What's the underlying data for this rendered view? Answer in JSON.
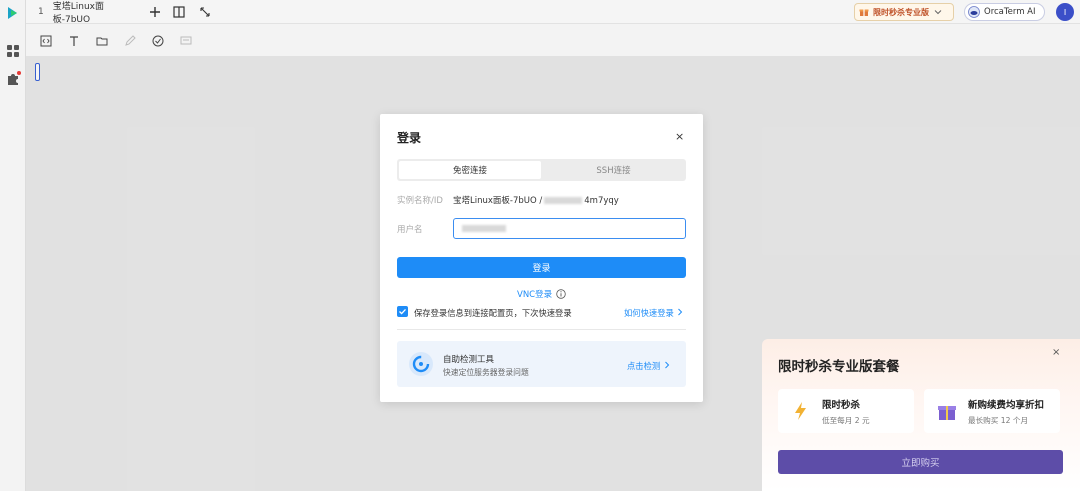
{
  "tab": {
    "number": "1",
    "title": "宝塔Linux面板-7bUO"
  },
  "header": {
    "promo_label": "限时秒杀专业版",
    "orca_label": "OrcaTerm AI",
    "avatar_initial": "I"
  },
  "modal": {
    "title": "登录",
    "close": "×",
    "tabs": [
      {
        "label": "免密连接",
        "active": true
      },
      {
        "label": "SSH连接",
        "active": false
      }
    ],
    "instance_label": "实例名称/ID",
    "instance_name": "宝塔Linux面板-7bUO /",
    "instance_id_suffix": "4m7yqy",
    "username_label": "用户名",
    "login_button": "登录",
    "vnc_link": "VNC登录",
    "save_checked": true,
    "save_label": "保存登录信息到连接配置页，下次快速登录",
    "quick_link": "如何快速登录",
    "tool_title": "自助检测工具",
    "tool_desc": "快速定位服务器登录问题",
    "tool_action": "点击检测"
  },
  "promo_panel": {
    "title": "限时秒杀专业版套餐",
    "close": "×",
    "cards": [
      {
        "title": "限时秒杀",
        "desc": "低至每月 2 元"
      },
      {
        "title": "新购续费均享折扣",
        "desc": "最长购买 12 个月"
      }
    ],
    "buy_button": "立即购买"
  },
  "colors": {
    "primary": "#1e8cf7",
    "buy": "#5d4da8",
    "promo_text": "#c0532a"
  }
}
